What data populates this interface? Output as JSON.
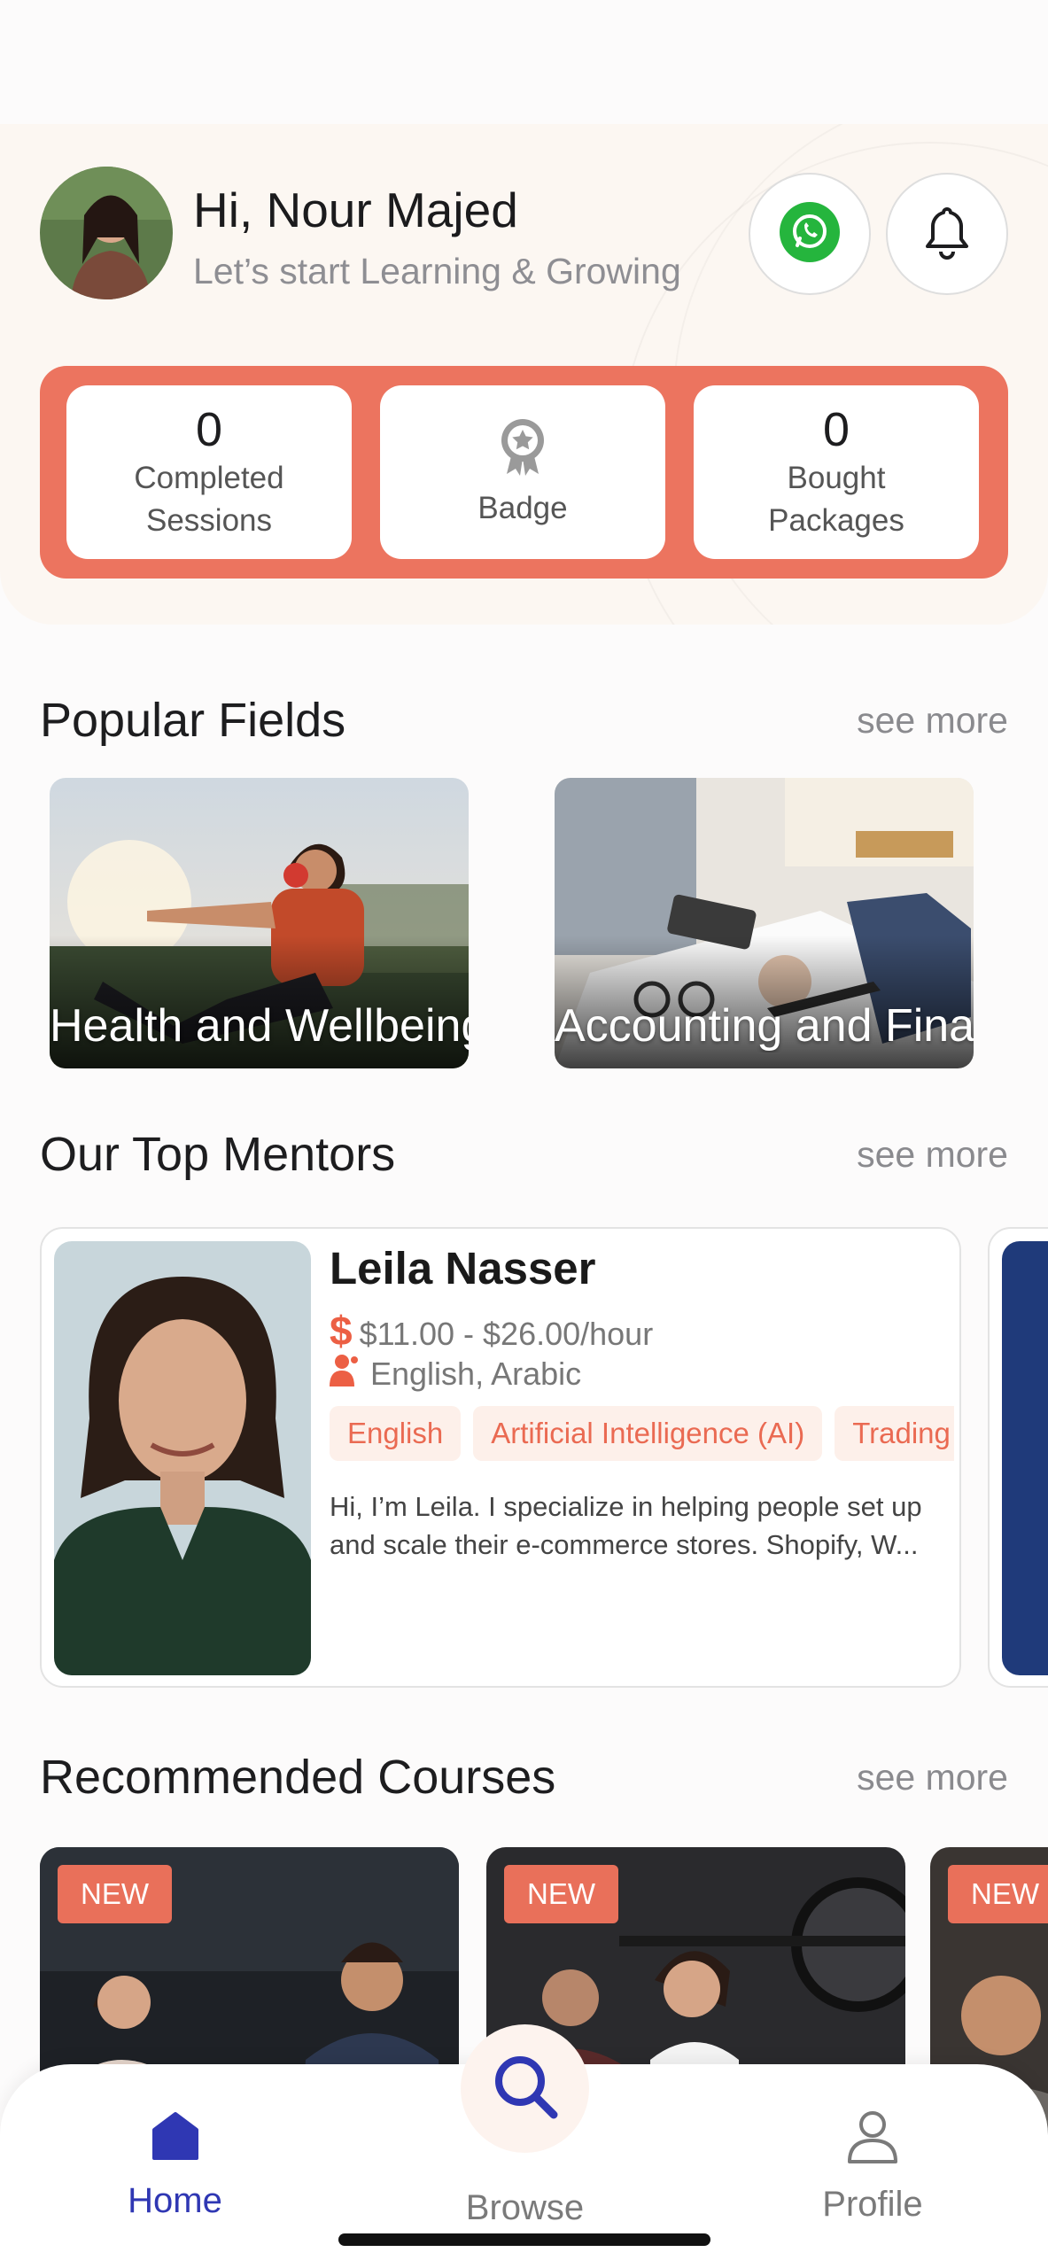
{
  "user": {
    "greeting": "Hi, Nour Majed",
    "subtitle": "Let’s start Learning & Growing"
  },
  "header_actions": {
    "whatsapp_icon": "whatsapp-icon",
    "bell_icon": "bell-icon"
  },
  "stats": [
    {
      "value": "0",
      "label": "Completed Sessions"
    },
    {
      "value": "",
      "label": "Badge",
      "icon": "badge-icon"
    },
    {
      "value": "0",
      "label": "Bought Packages"
    }
  ],
  "popular_fields": {
    "title": "Popular Fields",
    "see_more": "see more",
    "items": [
      {
        "label": "Health and Wellbeing"
      },
      {
        "label": "Accounting and Finance"
      }
    ]
  },
  "mentors": {
    "title": "Our Top Mentors",
    "see_more": "see more",
    "items": [
      {
        "name": "Leila Nasser",
        "price": "$11.00 - $26.00/hour",
        "currency_symbol": "$",
        "languages": "English, Arabic",
        "tags": [
          "English",
          "Artificial Intelligence (AI)",
          "Trading"
        ],
        "bio": "Hi, I’m Leila. I specialize in helping people set up and scale their e-commerce stores. Shopify, W..."
      }
    ]
  },
  "courses": {
    "title": "Recommended Courses",
    "see_more": "see more",
    "items": [
      {
        "badge": "NEW"
      },
      {
        "badge": "NEW"
      },
      {
        "badge": "NEW"
      }
    ]
  },
  "bottom_nav": {
    "home": "Home",
    "browse": "Browse",
    "profile": "Profile"
  },
  "colors": {
    "accent": "#ec745f",
    "nav_active": "#2f37b3",
    "whatsapp": "#25b53d"
  }
}
